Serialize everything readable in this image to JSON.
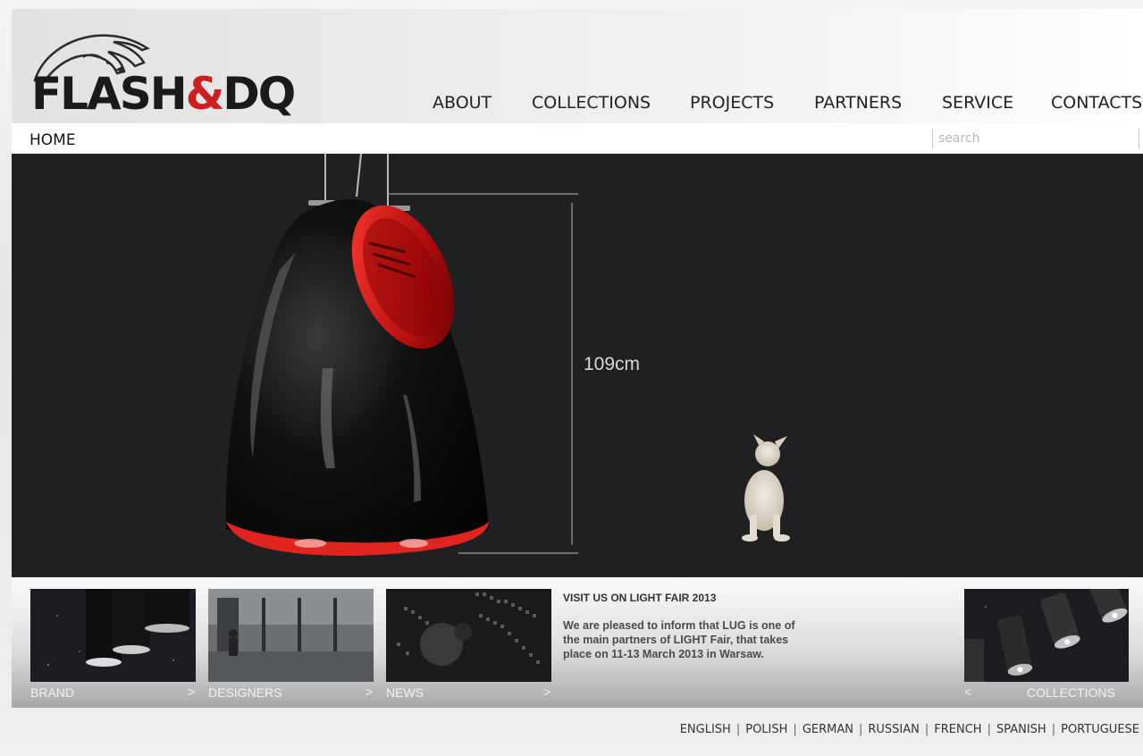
{
  "brand": {
    "logo_text_a": "FLASH",
    "logo_amp": "&",
    "logo_text_b": "DQ"
  },
  "nav": {
    "items": [
      "ABOUT",
      "COLLECTIONS",
      "PROJECTS",
      "PARTNERS",
      "SERVICE",
      "CONTACTS"
    ]
  },
  "subbar": {
    "home": "HOME",
    "search_placeholder": "search"
  },
  "hero": {
    "dimension_label": "109cm",
    "accent": "#e0241f"
  },
  "tiles": [
    {
      "label": "BRAND",
      "arrow": ">"
    },
    {
      "label": "DESIGNERS",
      "arrow": ">"
    },
    {
      "label": "NEWS",
      "arrow": ">"
    }
  ],
  "news": {
    "title": "VISIT US ON LIGHT FAIR 2013",
    "body": "We are pleased to inform that LUG is one of the main partners of LIGHT Fair, that takes place on 11-13 March 2013 in Warsaw."
  },
  "collections_tile": {
    "label": "COLLECTIONS",
    "arrow": "<"
  },
  "languages": [
    "ENGLISH",
    "POLISH",
    "GERMAN",
    "RUSSIAN",
    "FRENCH",
    "SPANISH",
    "PORTUGUESE"
  ]
}
